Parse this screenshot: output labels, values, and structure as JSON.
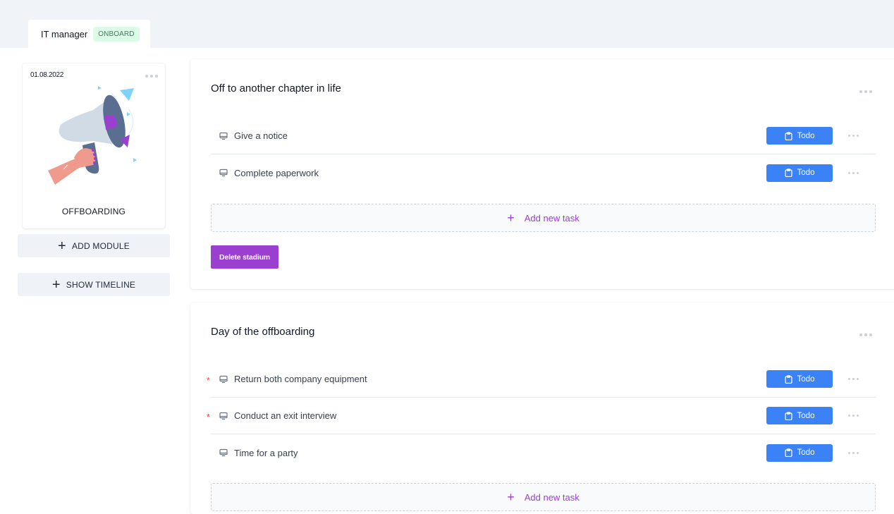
{
  "header": {
    "tab_label": "IT manager",
    "tab_badge": "ONBOARD",
    "badge_color": "#dcfce7"
  },
  "sidebar": {
    "module": {
      "date": "01.08.2022",
      "title": "OFFBOARDING",
      "illustration": "megaphone-in-hand"
    },
    "add_module_label": "ADD MODULE",
    "show_timeline_label": "SHOW TIMELINE"
  },
  "colors": {
    "primary_blue": "#3b82f6",
    "accent_purple": "#9b3fd0",
    "required_red": "#ef4444"
  },
  "stages": [
    {
      "title": "Off to another chapter in life",
      "tasks": [
        {
          "name": "Give a notice",
          "required": false,
          "status": "Todo"
        },
        {
          "name": "Complete paperwork",
          "required": false,
          "status": "Todo"
        }
      ],
      "add_task_label": "Add new task",
      "delete_label": "Delete stadium"
    },
    {
      "title": "Day of the offboarding",
      "tasks": [
        {
          "name": "Return both company equipment",
          "required": true,
          "required_mark": "*",
          "status": "Todo"
        },
        {
          "name": "Conduct an exit interview",
          "required": true,
          "required_mark": "*",
          "status": "Todo"
        },
        {
          "name": "Time for a party",
          "required": false,
          "status": "Todo"
        }
      ],
      "add_task_label": "Add new task"
    }
  ]
}
